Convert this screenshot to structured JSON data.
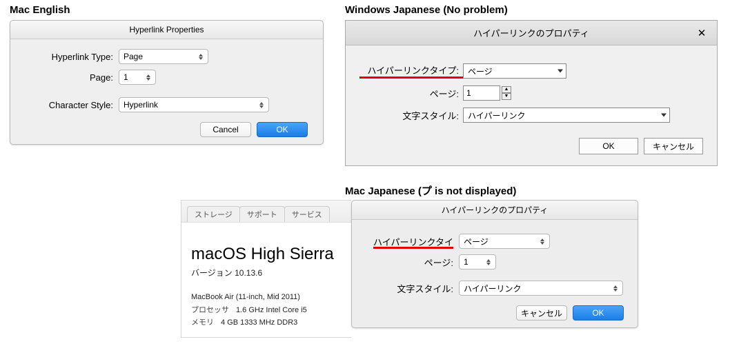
{
  "headings": {
    "mac_en": "Mac English",
    "win_jp": "Windows Japanese (No problem)",
    "mac_jp": "Mac Japanese (プ is not displayed)"
  },
  "mac_en": {
    "title": "Hyperlink Properties",
    "type_label": "Hyperlink Type:",
    "type_value": "Page",
    "page_label": "Page:",
    "page_value": "1",
    "style_label": "Character Style:",
    "style_value": "Hyperlink",
    "cancel": "Cancel",
    "ok": "OK"
  },
  "win_jp": {
    "title": "ハイパーリンクのプロパティ",
    "type_label": "ハイパーリンクタイプ:",
    "type_value": "ページ",
    "page_label": "ページ:",
    "page_value": "1",
    "style_label": "文字スタイル:",
    "style_value": "ハイパーリンク",
    "ok": "OK",
    "cancel": "キャンセル"
  },
  "about": {
    "tabs": [
      "ストレージ",
      "サポート",
      "サービス"
    ],
    "os_bold": "macOS",
    "os_rest": " High Sierra",
    "version": "バージョン 10.13.6",
    "model": "MacBook Air (11-inch, Mid 2011)",
    "cpu_label": "プロセッサ",
    "cpu_value": "1.6 GHz Intel Core i5",
    "mem_label": "メモリ",
    "mem_value": "4 GB 1333 MHz DDR3"
  },
  "mac_jp": {
    "title": "ハイパーリンクのプロパティ",
    "type_label": "ハイパーリンクタイ",
    "type_value": "ページ",
    "page_label": "ページ:",
    "page_value": "1",
    "style_label": "文字スタイル:",
    "style_value": "ハイパーリンク",
    "cancel": "キャンセル",
    "ok": "OK"
  }
}
